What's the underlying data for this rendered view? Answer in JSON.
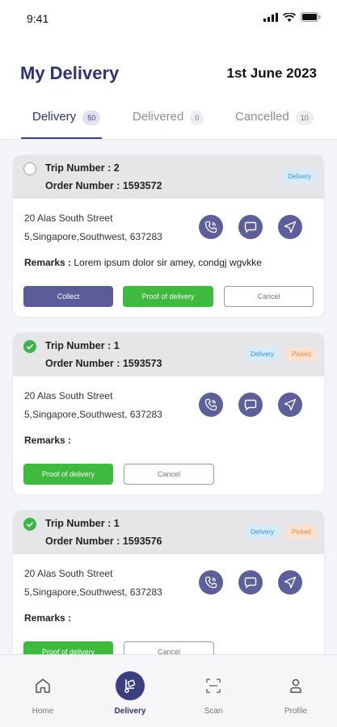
{
  "status_bar": {
    "time": "9:41"
  },
  "header": {
    "title": "My Delivery",
    "date": "1st June 2023"
  },
  "tabs": [
    {
      "label": "Delivery",
      "count": "50",
      "active": true
    },
    {
      "label": "Delivered",
      "count": "0",
      "active": false
    },
    {
      "label": "Cancelled",
      "count": "10",
      "active": false
    }
  ],
  "cards": [
    {
      "checked": false,
      "trip": "Trip Number : 2",
      "order": "Order Number : 1593572",
      "tags": [
        "Delivery"
      ],
      "address_line1": "20 Alas South Street",
      "address_line2": "5,Singapore,Southwest, 637283",
      "remarks_label": "Remarks :",
      "remarks_text": "Lorem ipsum dolor sir amey, condgj wgvkke",
      "buttons": [
        "Collect",
        "Proof of delivery",
        "Cancel"
      ]
    },
    {
      "checked": true,
      "trip": "Trip Number : 1",
      "order": "Order Number : 1593573",
      "tags": [
        "Delivery",
        "Picked"
      ],
      "address_line1": "20 Alas South Street",
      "address_line2": "5,Singapore,Southwest, 637283",
      "remarks_label": "Remarks :",
      "remarks_text": "",
      "buttons": [
        "Proof of delivery",
        "Cancel"
      ]
    },
    {
      "checked": true,
      "trip": "Trip Number : 1",
      "order": "Order Number : 1593576",
      "tags": [
        "Delivery",
        "Picked"
      ],
      "address_line1": "20 Alas South Street",
      "address_line2": "5,Singapore,Southwest, 637283",
      "remarks_label": "Remarks :",
      "remarks_text": "",
      "buttons": [
        "Proof of delivery",
        "Cancel"
      ]
    }
  ],
  "bottom_nav": [
    {
      "label": "Home",
      "icon": "home-icon"
    },
    {
      "label": "Delivery",
      "icon": "delivery-icon",
      "active": true
    },
    {
      "label": "Scan",
      "icon": "scan-icon"
    },
    {
      "label": "Profile",
      "icon": "profile-icon"
    }
  ],
  "colors": {
    "primary": "#3b3f80",
    "green": "#3eba3f",
    "delivery_tag": "#d6ecfb",
    "picked_tag": "#fde3cf"
  }
}
